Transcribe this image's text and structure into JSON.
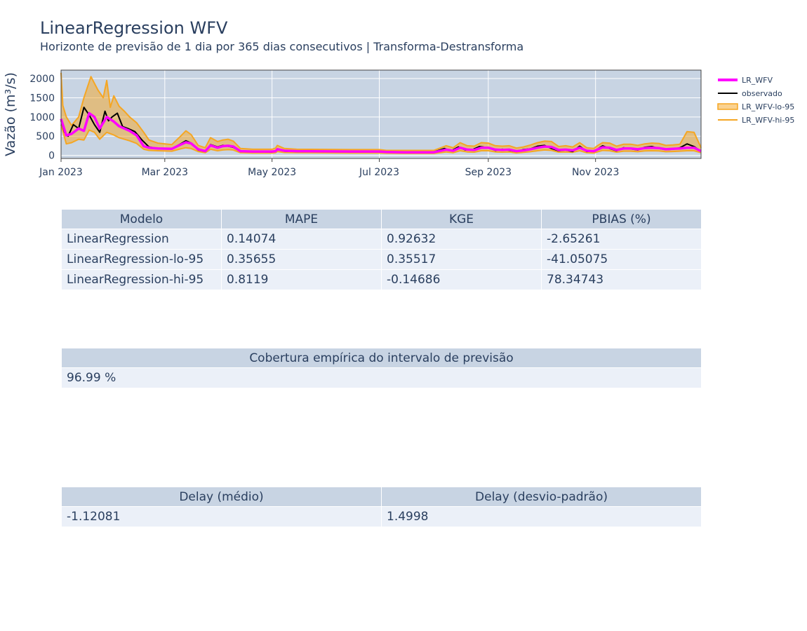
{
  "title": "LinearRegression WFV",
  "subtitle": "Horizonte de previsão de 1 dia por 365 dias consecutivos | Transforma-Destransforma",
  "chart_data": {
    "type": "line",
    "ylabel": "Vazão (m³/s)",
    "ylim": [
      -80,
      2220
    ],
    "yticks": [
      0,
      500,
      1000,
      1500,
      2000
    ],
    "xrange": [
      "2023-01-01",
      "2023-12-31"
    ],
    "xticks": [
      {
        "date": "2023-01-01",
        "label": "Jan 2023"
      },
      {
        "date": "2023-03-01",
        "label": "Mar 2023"
      },
      {
        "date": "2023-05-01",
        "label": "May 2023"
      },
      {
        "date": "2023-07-01",
        "label": "Jul 2023"
      },
      {
        "date": "2023-09-01",
        "label": "Sep 2023"
      },
      {
        "date": "2023-11-01",
        "label": "Nov 2023"
      }
    ],
    "grid": true,
    "legend_position": "right",
    "colors": {
      "plot_bg": "#c8d4e3",
      "grid": "#ffffff",
      "prediction": "#ff00ff",
      "observed": "#000000",
      "band": "#f5a623",
      "band_fill": "rgba(245,166,35,0.5)"
    },
    "series": [
      {
        "name": "LR_WFV",
        "key": "prediction",
        "x": [
          "2023-01-01",
          "2023-01-04",
          "2023-01-07",
          "2023-01-11",
          "2023-01-14",
          "2023-01-17",
          "2023-01-20",
          "2023-01-23",
          "2023-01-27",
          "2023-01-31",
          "2023-02-03",
          "2023-02-06",
          "2023-02-09",
          "2023-02-13",
          "2023-02-17",
          "2023-02-20",
          "2023-02-25",
          "2023-03-05",
          "2023-03-10",
          "2023-03-13",
          "2023-03-16",
          "2023-03-20",
          "2023-03-24",
          "2023-03-27",
          "2023-03-31",
          "2023-04-03",
          "2023-04-06",
          "2023-04-09",
          "2023-04-13",
          "2023-04-20",
          "2023-05-01",
          "2023-05-03",
          "2023-05-04",
          "2023-05-08",
          "2023-05-15",
          "2023-06-15",
          "2023-07-01",
          "2023-07-05",
          "2023-07-15",
          "2023-08-01",
          "2023-08-08",
          "2023-08-12",
          "2023-08-16",
          "2023-08-20",
          "2023-08-24",
          "2023-08-28",
          "2023-09-01",
          "2023-09-05",
          "2023-09-09",
          "2023-09-13",
          "2023-09-17",
          "2023-09-21",
          "2023-09-25",
          "2023-09-29",
          "2023-10-03",
          "2023-10-07",
          "2023-10-11",
          "2023-10-15",
          "2023-10-19",
          "2023-10-23",
          "2023-10-27",
          "2023-10-31",
          "2023-11-02",
          "2023-11-05",
          "2023-11-09",
          "2023-11-13",
          "2023-11-17",
          "2023-11-21",
          "2023-11-25",
          "2023-11-29",
          "2023-12-03",
          "2023-12-07",
          "2023-12-11",
          "2023-12-15",
          "2023-12-19",
          "2023-12-23",
          "2023-12-27",
          "2023-12-31"
        ],
        "y": [
          950,
          520,
          560,
          700,
          640,
          1100,
          1000,
          700,
          1000,
          880,
          760,
          700,
          640,
          520,
          240,
          200,
          180,
          170,
          280,
          340,
          310,
          160,
          110,
          260,
          200,
          240,
          250,
          230,
          110,
          100,
          100,
          110,
          160,
          120,
          110,
          100,
          100,
          90,
          80,
          80,
          150,
          120,
          200,
          150,
          140,
          200,
          200,
          150,
          140,
          150,
          110,
          130,
          160,
          200,
          230,
          220,
          140,
          150,
          130,
          200,
          120,
          110,
          150,
          210,
          200,
          140,
          180,
          180,
          160,
          190,
          200,
          190,
          160,
          170,
          180,
          200,
          200,
          110
        ]
      },
      {
        "name": "observado",
        "key": "observed",
        "x": [
          "2023-01-01",
          "2023-01-03",
          "2023-01-05",
          "2023-01-08",
          "2023-01-11",
          "2023-01-14",
          "2023-01-17",
          "2023-01-20",
          "2023-01-23",
          "2023-01-26",
          "2023-01-28",
          "2023-01-30",
          "2023-02-02",
          "2023-02-05",
          "2023-02-08",
          "2023-02-12",
          "2023-02-16",
          "2023-02-20",
          "2023-02-25",
          "2023-03-05",
          "2023-03-10",
          "2023-03-13",
          "2023-03-16",
          "2023-03-20",
          "2023-03-24",
          "2023-03-27",
          "2023-03-31",
          "2023-04-03",
          "2023-04-06",
          "2023-04-09",
          "2023-04-13",
          "2023-04-20",
          "2023-05-01",
          "2023-05-03",
          "2023-05-04",
          "2023-05-08",
          "2023-05-15",
          "2023-06-15",
          "2023-07-01",
          "2023-07-06",
          "2023-07-15",
          "2023-08-01",
          "2023-08-07",
          "2023-08-11",
          "2023-08-15",
          "2023-08-19",
          "2023-08-23",
          "2023-08-27",
          "2023-09-01",
          "2023-09-05",
          "2023-09-09",
          "2023-09-13",
          "2023-09-17",
          "2023-09-21",
          "2023-09-25",
          "2023-09-29",
          "2023-10-03",
          "2023-10-07",
          "2023-10-11",
          "2023-10-15",
          "2023-10-19",
          "2023-10-23",
          "2023-10-27",
          "2023-10-31",
          "2023-11-02",
          "2023-11-05",
          "2023-11-09",
          "2023-11-13",
          "2023-11-17",
          "2023-11-21",
          "2023-11-25",
          "2023-11-29",
          "2023-12-03",
          "2023-12-07",
          "2023-12-11",
          "2023-12-15",
          "2023-12-19",
          "2023-12-23",
          "2023-12-27",
          "2023-12-31"
        ],
        "y": [
          900,
          600,
          500,
          800,
          700,
          1250,
          1050,
          800,
          600,
          1150,
          900,
          1000,
          1100,
          750,
          700,
          620,
          400,
          220,
          180,
          170,
          300,
          380,
          320,
          140,
          100,
          280,
          220,
          260,
          240,
          210,
          100,
          100,
          90,
          120,
          170,
          110,
          100,
          95,
          95,
          80,
          80,
          90,
          180,
          120,
          220,
          140,
          150,
          230,
          200,
          130,
          160,
          130,
          100,
          150,
          170,
          240,
          260,
          180,
          120,
          140,
          100,
          240,
          100,
          120,
          160,
          250,
          180,
          120,
          200,
          170,
          140,
          210,
          230,
          180,
          150,
          160,
          200,
          300,
          230,
          100
        ]
      },
      {
        "name": "LR_WFV-lo-95",
        "key": "lower",
        "x": [
          "2023-01-01",
          "2023-01-04",
          "2023-01-07",
          "2023-01-11",
          "2023-01-14",
          "2023-01-17",
          "2023-01-20",
          "2023-01-23",
          "2023-01-27",
          "2023-01-31",
          "2023-02-03",
          "2023-02-06",
          "2023-02-09",
          "2023-02-13",
          "2023-02-17",
          "2023-02-20",
          "2023-02-25",
          "2023-03-05",
          "2023-03-10",
          "2023-03-13",
          "2023-03-16",
          "2023-03-20",
          "2023-03-24",
          "2023-03-27",
          "2023-03-31",
          "2023-04-03",
          "2023-04-06",
          "2023-04-09",
          "2023-04-13",
          "2023-04-20",
          "2023-05-01",
          "2023-05-03",
          "2023-05-04",
          "2023-05-08",
          "2023-05-15",
          "2023-06-15",
          "2023-07-01",
          "2023-07-05",
          "2023-07-15",
          "2023-08-01",
          "2023-08-08",
          "2023-08-12",
          "2023-08-16",
          "2023-08-20",
          "2023-08-24",
          "2023-08-28",
          "2023-09-01",
          "2023-09-05",
          "2023-09-09",
          "2023-09-13",
          "2023-09-17",
          "2023-09-21",
          "2023-09-25",
          "2023-09-29",
          "2023-10-03",
          "2023-10-07",
          "2023-10-11",
          "2023-10-15",
          "2023-10-19",
          "2023-10-23",
          "2023-10-27",
          "2023-10-31",
          "2023-11-02",
          "2023-11-05",
          "2023-11-09",
          "2023-11-13",
          "2023-11-17",
          "2023-11-21",
          "2023-11-25",
          "2023-11-29",
          "2023-12-03",
          "2023-12-07",
          "2023-12-11",
          "2023-12-15",
          "2023-12-19",
          "2023-12-23",
          "2023-12-27",
          "2023-12-31"
        ],
        "y": [
          800,
          300,
          330,
          420,
          400,
          660,
          600,
          420,
          600,
          530,
          460,
          420,
          380,
          310,
          160,
          130,
          120,
          110,
          170,
          200,
          180,
          100,
          70,
          160,
          120,
          140,
          150,
          140,
          70,
          60,
          60,
          70,
          100,
          75,
          70,
          60,
          60,
          55,
          50,
          50,
          90,
          70,
          120,
          90,
          85,
          120,
          120,
          90,
          85,
          90,
          65,
          80,
          95,
          120,
          140,
          130,
          85,
          90,
          80,
          120,
          70,
          65,
          90,
          130,
          120,
          85,
          110,
          110,
          95,
          115,
          120,
          115,
          95,
          100,
          110,
          120,
          120,
          70
        ]
      },
      {
        "name": "LR_WFV-hi-95",
        "key": "upper",
        "x": [
          "2023-01-01",
          "2023-01-02",
          "2023-01-04",
          "2023-01-07",
          "2023-01-11",
          "2023-01-14",
          "2023-01-18",
          "2023-01-22",
          "2023-01-25",
          "2023-01-27",
          "2023-01-29",
          "2023-01-31",
          "2023-02-03",
          "2023-02-06",
          "2023-02-09",
          "2023-02-13",
          "2023-02-17",
          "2023-02-20",
          "2023-02-25",
          "2023-03-05",
          "2023-03-10",
          "2023-03-13",
          "2023-03-16",
          "2023-03-20",
          "2023-03-24",
          "2023-03-27",
          "2023-03-31",
          "2023-04-03",
          "2023-04-06",
          "2023-04-09",
          "2023-04-13",
          "2023-04-20",
          "2023-05-01",
          "2023-05-03",
          "2023-05-04",
          "2023-05-08",
          "2023-05-15",
          "2023-06-15",
          "2023-07-01",
          "2023-07-05",
          "2023-07-15",
          "2023-08-01",
          "2023-08-08",
          "2023-08-12",
          "2023-08-16",
          "2023-08-20",
          "2023-08-24",
          "2023-08-28",
          "2023-09-01",
          "2023-09-05",
          "2023-09-09",
          "2023-09-13",
          "2023-09-17",
          "2023-09-21",
          "2023-09-25",
          "2023-09-29",
          "2023-10-03",
          "2023-10-07",
          "2023-10-11",
          "2023-10-15",
          "2023-10-19",
          "2023-10-23",
          "2023-10-27",
          "2023-10-31",
          "2023-11-02",
          "2023-11-05",
          "2023-11-09",
          "2023-11-13",
          "2023-11-17",
          "2023-11-21",
          "2023-11-25",
          "2023-11-29",
          "2023-12-03",
          "2023-12-07",
          "2023-12-11",
          "2023-12-15",
          "2023-12-19",
          "2023-12-23",
          "2023-12-27",
          "2023-12-31"
        ],
        "y": [
          2150,
          1300,
          1000,
          780,
          1000,
          1500,
          2050,
          1700,
          1500,
          1950,
          1250,
          1550,
          1280,
          1150,
          1000,
          850,
          600,
          400,
          320,
          280,
          500,
          640,
          540,
          260,
          200,
          460,
          360,
          400,
          420,
          370,
          180,
          160,
          160,
          190,
          260,
          180,
          160,
          150,
          150,
          130,
          130,
          130,
          250,
          200,
          330,
          250,
          240,
          330,
          320,
          250,
          240,
          250,
          190,
          220,
          270,
          330,
          370,
          360,
          230,
          250,
          220,
          330,
          200,
          180,
          250,
          330,
          320,
          240,
          290,
          290,
          260,
          300,
          320,
          310,
          260,
          270,
          290,
          620,
          600,
          200
        ]
      }
    ]
  },
  "metrics_table": {
    "headers": [
      "Modelo",
      "MAPE",
      "KGE",
      "PBIAS (%)"
    ],
    "rows": [
      [
        "LinearRegression",
        "0.14074",
        "0.92632",
        "-2.65261"
      ],
      [
        "LinearRegression-lo-95",
        "0.35655",
        "0.35517",
        "-41.05075"
      ],
      [
        "LinearRegression-hi-95",
        "0.8119",
        "-0.14686",
        "78.34743"
      ]
    ]
  },
  "coverage_table": {
    "header": "Cobertura empírica do intervalo de previsão",
    "value": "96.99 %"
  },
  "delay_table": {
    "headers": [
      "Delay (médio)",
      "Delay (desvio-padrão)"
    ],
    "values": [
      "-1.12081",
      "1.4998"
    ]
  }
}
